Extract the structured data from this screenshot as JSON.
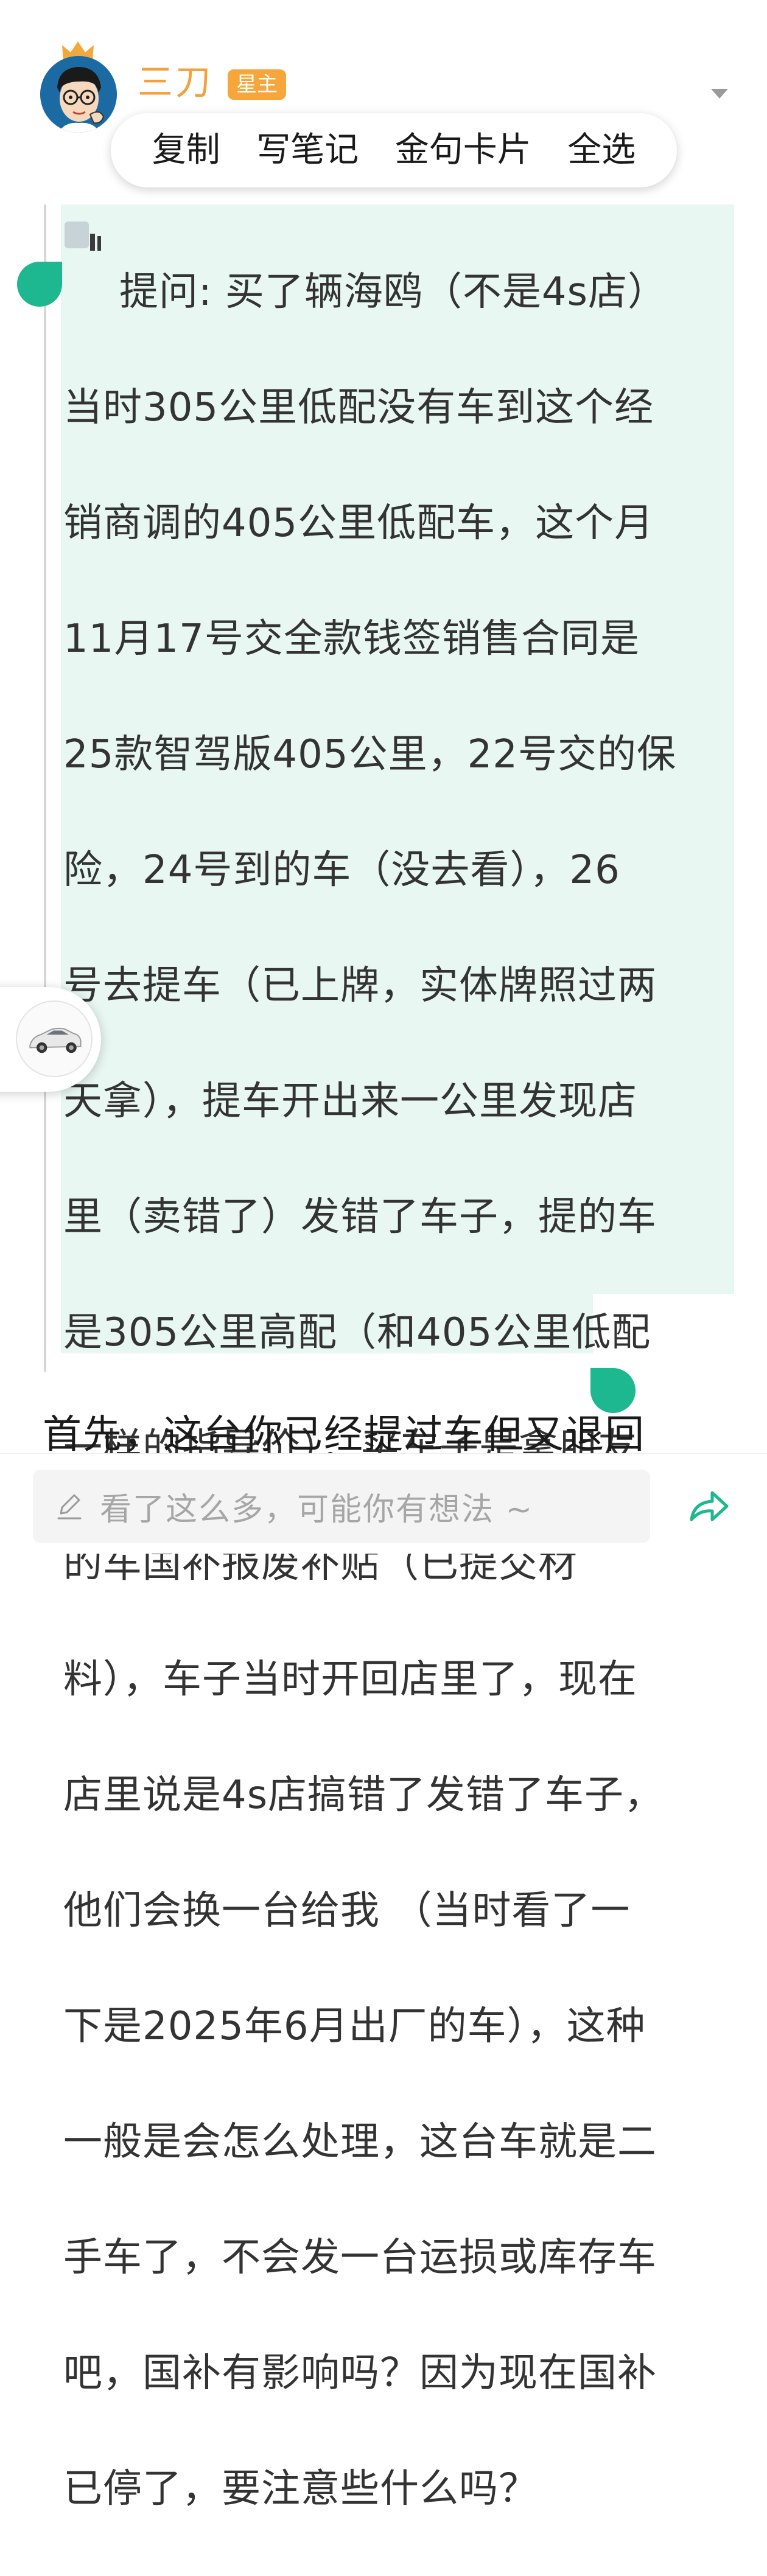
{
  "author": {
    "name": "三刀",
    "badge": "星主"
  },
  "context_menu": [
    "复制",
    "写笔记",
    "金句卡片",
    "全选"
  ],
  "question": {
    "lines": [
      "提问: 买了辆海鸥（不是4s店）",
      "当时305公里低配没有车到这个经",
      "销商调的405公里低配车，这个月",
      "11月17号交全款钱签销售合同是",
      "25款智驾版405公里，22号交的保",
      "险，24号到的车（没去看），26",
      "号去提车（已上牌，实体牌照过两",
      "天拿），提车开出来一公里发现店",
      "里（卖错了）发错了车子，提的车",
      "是305公里高配（和405公里低配",
      "一样的指导价），买车子是拿朋友",
      "的车国补报废补贴（已提交材",
      "料），车子当时开回店里了，现在",
      "店里说是4s店搞错了发错了车子，",
      "他们会换一台给我 （当时看了一",
      "下是2025年6月出厂的车），这种",
      "一般是会怎么处理，这台车就是二",
      "手车了，不会发一台运损或库存车",
      "吧，国补有影响吗？因为现在国补",
      "已停了，要注意些什么吗？"
    ]
  },
  "answer": {
    "first_line": "首先，这台你已经提过车但又退回"
  },
  "bottom_bar": {
    "comment_placeholder": "看了这么多，可能你有想法 ~"
  },
  "colors": {
    "accent": "#1db790",
    "highlight": "#e8f7f1",
    "username": "#f3a13a",
    "badge": "#f6a63a"
  },
  "icons": [
    "crown-icon",
    "avatar",
    "collapse-arrow-icon",
    "question-icon",
    "car-icon",
    "pencil-icon",
    "share-icon"
  ]
}
